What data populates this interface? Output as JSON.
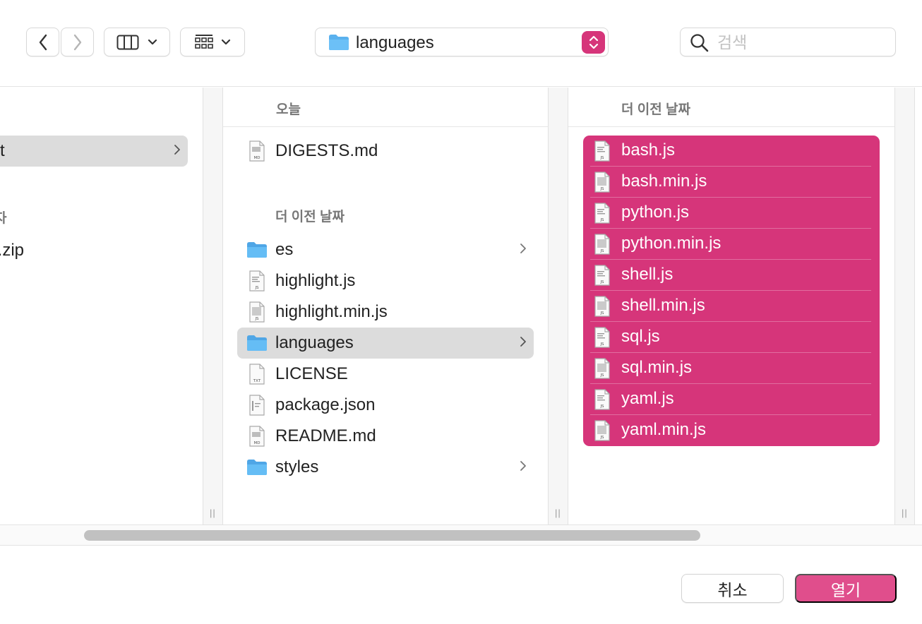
{
  "toolbar": {
    "back_label": "back",
    "forward_label": "forward",
    "view_mode": "column-view",
    "group_mode": "group-by",
    "path_popup_value": "languages",
    "search_placeholder": "검색"
  },
  "columns": {
    "left_partial": {
      "items": [
        {
          "name": "t",
          "selected": true,
          "has_children": true
        },
        {
          "name": "t.zip"
        }
      ],
      "section_fragment": "자"
    },
    "middle": {
      "header": "오늘",
      "today_items": [
        {
          "name": "DIGESTS.md",
          "type": "md-file",
          "icon": "md-file-icon"
        }
      ],
      "older_header": "더 이전 날짜",
      "older_items": [
        {
          "name": "es",
          "type": "folder",
          "icon": "folder-icon",
          "has_children": true
        },
        {
          "name": "highlight.js",
          "type": "js-file",
          "icon": "js-file-icon"
        },
        {
          "name": "highlight.min.js",
          "type": "js-file",
          "icon": "js-file-icon"
        },
        {
          "name": "languages",
          "type": "folder",
          "icon": "folder-icon",
          "has_children": true,
          "selected": true
        },
        {
          "name": "LICENSE",
          "type": "txt-file",
          "icon": "txt-file-icon"
        },
        {
          "name": "package.json",
          "type": "json-file",
          "icon": "json-file-icon"
        },
        {
          "name": "README.md",
          "type": "md-file",
          "icon": "md-file-icon"
        },
        {
          "name": "styles",
          "type": "folder",
          "icon": "folder-icon",
          "has_children": true
        }
      ]
    },
    "right": {
      "header": "더 이전 날짜",
      "selected_items": [
        {
          "name": "bash.js"
        },
        {
          "name": "bash.min.js"
        },
        {
          "name": "python.js"
        },
        {
          "name": "python.min.js"
        },
        {
          "name": "shell.js"
        },
        {
          "name": "shell.min.js"
        },
        {
          "name": "sql.js"
        },
        {
          "name": "sql.min.js"
        },
        {
          "name": "yaml.js"
        },
        {
          "name": "yaml.min.js"
        }
      ]
    }
  },
  "column_grip": "||",
  "footer": {
    "cancel_label": "취소",
    "open_label": "열기"
  },
  "colors": {
    "accent": "#d6357a",
    "open_button": "#e04e8c",
    "folder": "#5ab1ee",
    "selection_gray": "#dcdcdc"
  }
}
